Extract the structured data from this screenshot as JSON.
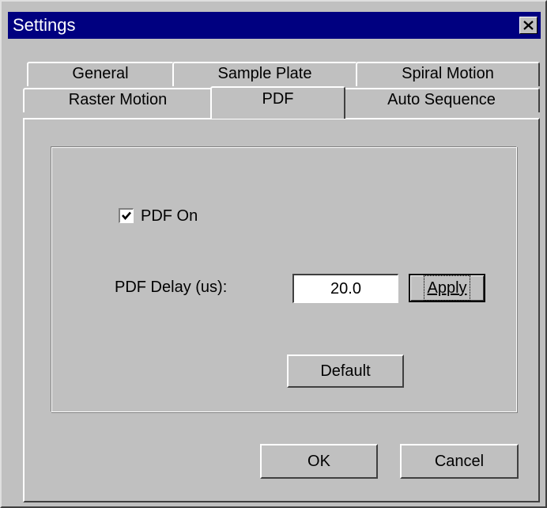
{
  "window": {
    "title": "Settings"
  },
  "tabs": {
    "back_row": [
      {
        "label": "General"
      },
      {
        "label": "Sample Plate"
      },
      {
        "label": "Spiral Motion"
      }
    ],
    "front_row": [
      {
        "label": "Raster Motion"
      },
      {
        "label": "PDF",
        "active": true
      },
      {
        "label": "Auto Sequence"
      }
    ]
  },
  "pdf": {
    "pdf_on_label": "PDF On",
    "pdf_on_checked": true,
    "delay_label": "PDF Delay (us):",
    "delay_value": "20.0",
    "apply_label": "Apply",
    "default_label": "Default"
  },
  "footer": {
    "ok_label": "OK",
    "cancel_label": "Cancel"
  },
  "icons": {
    "close": "close-icon",
    "check": "checkmark-icon"
  },
  "colors": {
    "titlebar": "#000080",
    "face": "#c0c0c0"
  }
}
